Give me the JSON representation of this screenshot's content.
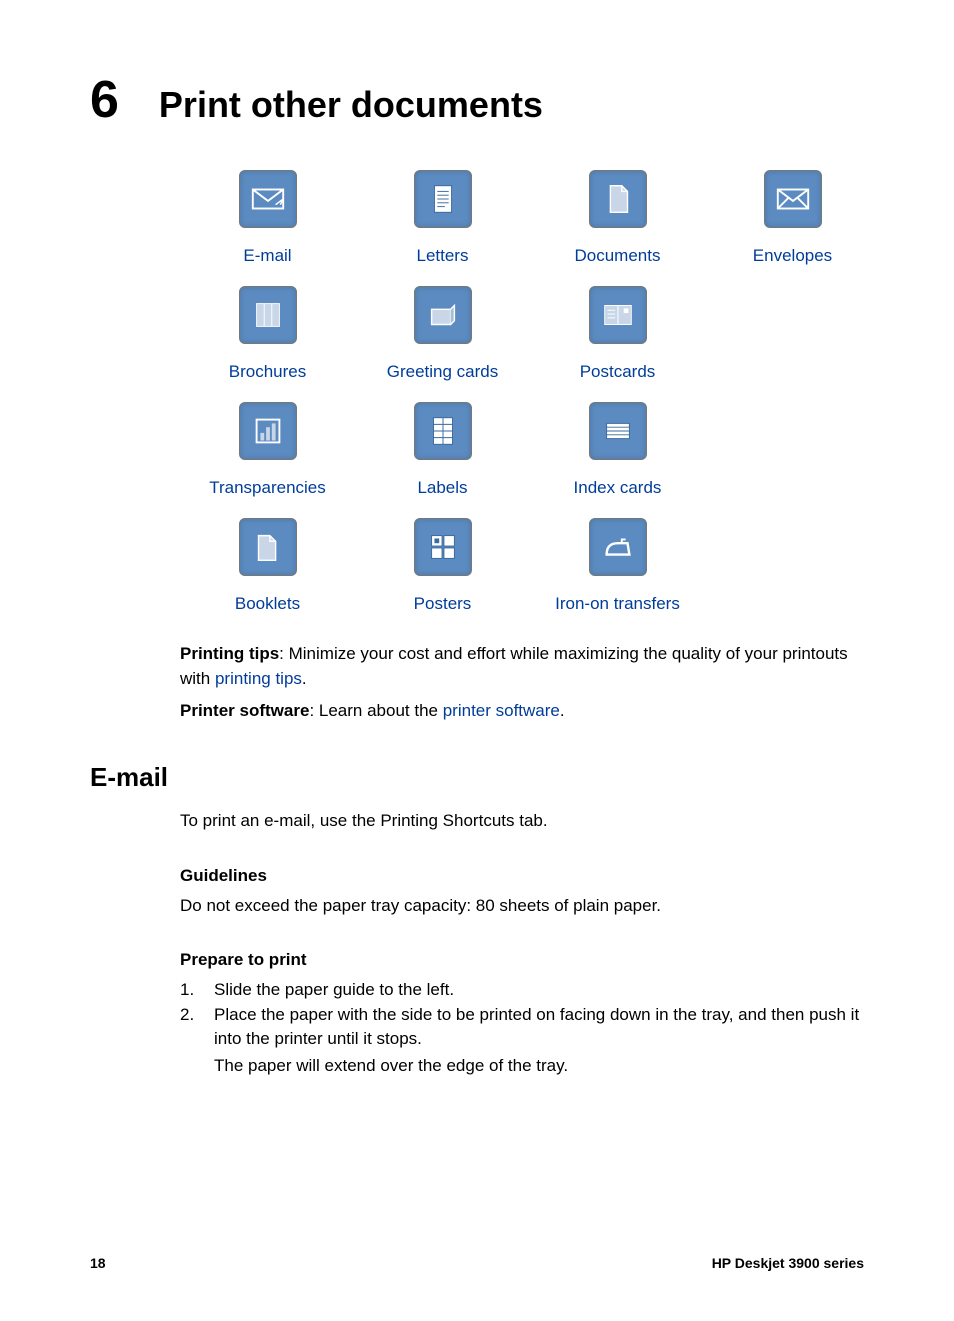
{
  "chapter": {
    "number": "6",
    "title": "Print other documents"
  },
  "grid": [
    {
      "label": "E-mail",
      "icon": "email-icon"
    },
    {
      "label": "Letters",
      "icon": "letters-icon"
    },
    {
      "label": "Documents",
      "icon": "documents-icon"
    },
    {
      "label": "Envelopes",
      "icon": "envelopes-icon"
    },
    {
      "label": "Brochures",
      "icon": "brochures-icon"
    },
    {
      "label": "Greeting cards",
      "icon": "greeting-cards-icon"
    },
    {
      "label": "Postcards",
      "icon": "postcards-icon"
    },
    {
      "label": "",
      "icon": ""
    },
    {
      "label": "Transparencies",
      "icon": "transparencies-icon"
    },
    {
      "label": "Labels",
      "icon": "labels-icon"
    },
    {
      "label": "Index cards",
      "icon": "index-cards-icon"
    },
    {
      "label": "",
      "icon": ""
    },
    {
      "label": "Booklets",
      "icon": "booklets-icon"
    },
    {
      "label": "Posters",
      "icon": "posters-icon"
    },
    {
      "label": "Iron-on transfers",
      "icon": "iron-on-icon"
    },
    {
      "label": "",
      "icon": ""
    }
  ],
  "tips": {
    "printing_bold": "Printing tips",
    "printing_text_a": ": Minimize your cost and effort while maximizing the quality of your printouts with ",
    "printing_link": "printing tips",
    "dot": ".",
    "software_bold": "Printer software",
    "software_text_a": ": Learn about the ",
    "software_link": "printer software"
  },
  "section": {
    "title": "E-mail",
    "intro": "To print an e-mail, use the Printing Shortcuts tab.",
    "guidelines_head": "Guidelines",
    "guidelines_text": "Do not exceed the paper tray capacity: 80 sheets of plain paper.",
    "prepare_head": "Prepare to print",
    "steps": [
      {
        "n": "1.",
        "text": [
          "Slide the paper guide to the left."
        ]
      },
      {
        "n": "2.",
        "text": [
          "Place the paper with the side to be printed on facing down in the tray, and then push it into the printer until it stops.",
          "The paper will extend over the edge of the tray."
        ]
      }
    ]
  },
  "footer": {
    "page": "18",
    "product": "HP Deskjet 3900 series"
  }
}
